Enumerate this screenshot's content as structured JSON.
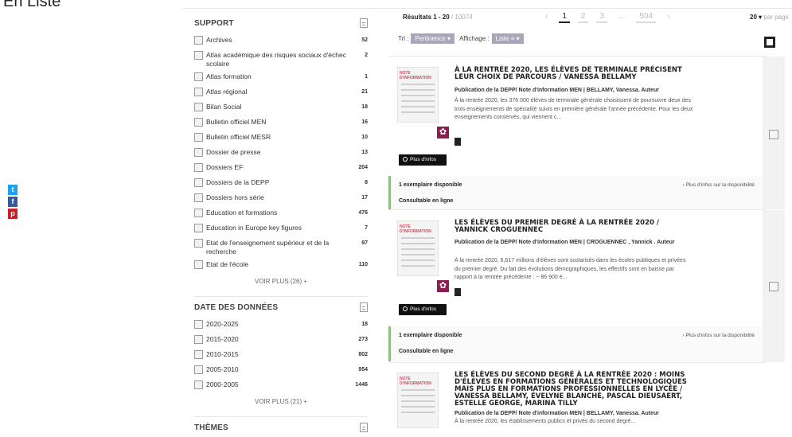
{
  "page": {
    "heading": "En Liste"
  },
  "social": [
    "twitter-icon",
    "facebook-icon",
    "pinterest-icon"
  ],
  "facets": [
    {
      "title": "SUPPORT",
      "items": [
        {
          "label": "Archives",
          "count": "52"
        },
        {
          "label": "Atlas académique des risques sociaux d'échec scolaire",
          "count": "2"
        },
        {
          "label": "Atlas formation",
          "count": "1"
        },
        {
          "label": "Atlas régional",
          "count": "21"
        },
        {
          "label": "Bilan Social",
          "count": "18"
        },
        {
          "label": "Bulletin officiel MEN",
          "count": "16"
        },
        {
          "label": "Bulletin officiel MESR",
          "count": "10"
        },
        {
          "label": "Dossier de presse",
          "count": "13"
        },
        {
          "label": "Dossiers EF",
          "count": "204"
        },
        {
          "label": "Dossiers de la DEPP",
          "count": "8"
        },
        {
          "label": "Dossiers hors série",
          "count": "17"
        },
        {
          "label": "Education et formations",
          "count": "476"
        },
        {
          "label": "Education in Europe key figures",
          "count": "7"
        },
        {
          "label": "Etat de l'enseignement supérieur et de la recherche",
          "count": "97"
        },
        {
          "label": "Etat de l'école",
          "count": "110"
        }
      ],
      "more": "VOIR PLUS (26) +"
    },
    {
      "title": "DATE DES DONNÉES",
      "items": [
        {
          "label": "2020-2025",
          "count": "18"
        },
        {
          "label": "2015-2020",
          "count": "273"
        },
        {
          "label": "2010-2015",
          "count": "802"
        },
        {
          "label": "2005-2010",
          "count": "954"
        },
        {
          "label": "2000-2005",
          "count": "1446"
        }
      ],
      "more": "VOIR PLUS (21) +"
    },
    {
      "title": "THÈMES",
      "items": [],
      "more": ""
    }
  ],
  "results_header": {
    "label": "Résultats 1 - 20",
    "total": " / 10074",
    "prev": "‹",
    "pages": [
      "1",
      "2",
      "3"
    ],
    "ellipsis": "...",
    "last": "504",
    "next": "›",
    "per_page_value": "20 ▾",
    "per_page_label": " par page"
  },
  "sort": {
    "tri_label": "Tri :",
    "tri_value": "Pertinence ▾",
    "aff_label": "Affichage :",
    "aff_value": "Liste ≡ ▾"
  },
  "results": [
    {
      "title": "À la rentrée 2020, les élèves de terminale précisent leur choix de parcours / Vanessa Bellamy",
      "publisher": "Publication de la DEPP/ Note d'information MEN | BELLAMY, Vanessa. Auteur",
      "summary": "À la rentrée 2020, les 376 000 élèves de terminale générale choisissent de poursuivre deux des trois enseignements de spécialité suivis en première générale l'année précédente. Pour les deux enseignements conservés, qui viennent c...",
      "more": "Plus d'infos",
      "availability": "1 exemplaire disponible",
      "availability_link": "› Plus d'infos sur la disponibilité",
      "online": "Consultable en ligne"
    },
    {
      "title": "Les élèves du premier degré à la rentrée 2020 / Yannick Croguennec",
      "publisher": "Publication de la DEPP/ Note d'information MEN | CROGUENNEC , Yannick . Auteur",
      "summary": "À la rentrée 2020, 6,617 millions d'élèves sont scolarisés dans les écoles publiques et privées du premier degré. Du fait des évolutions démographiques, les effectifs sont en baisse par rapport à la rentrée précédente : − 86 900 é...",
      "more": "Plus d'infos",
      "availability": "1 exemplaire disponible",
      "availability_link": "› Plus d'infos sur la disponibilité",
      "online": "Consultable en ligne"
    },
    {
      "title": "Les élèves du second degré à la rentrée 2020 : moins d'élèves en formations générales et technologiques mais plus en formations professionnelles en lycée / Vanessa Bellamy, Évelyne Blanché, Pascal Dieusaert, Estelle George, Marina Tilly",
      "publisher": "Publication de la DEPP/ Note d'information MEN | BELLAMY, Vanessa. Auteur",
      "summary": "À la rentrée 2020, les établissements publics et privés du second degré..."
    }
  ]
}
